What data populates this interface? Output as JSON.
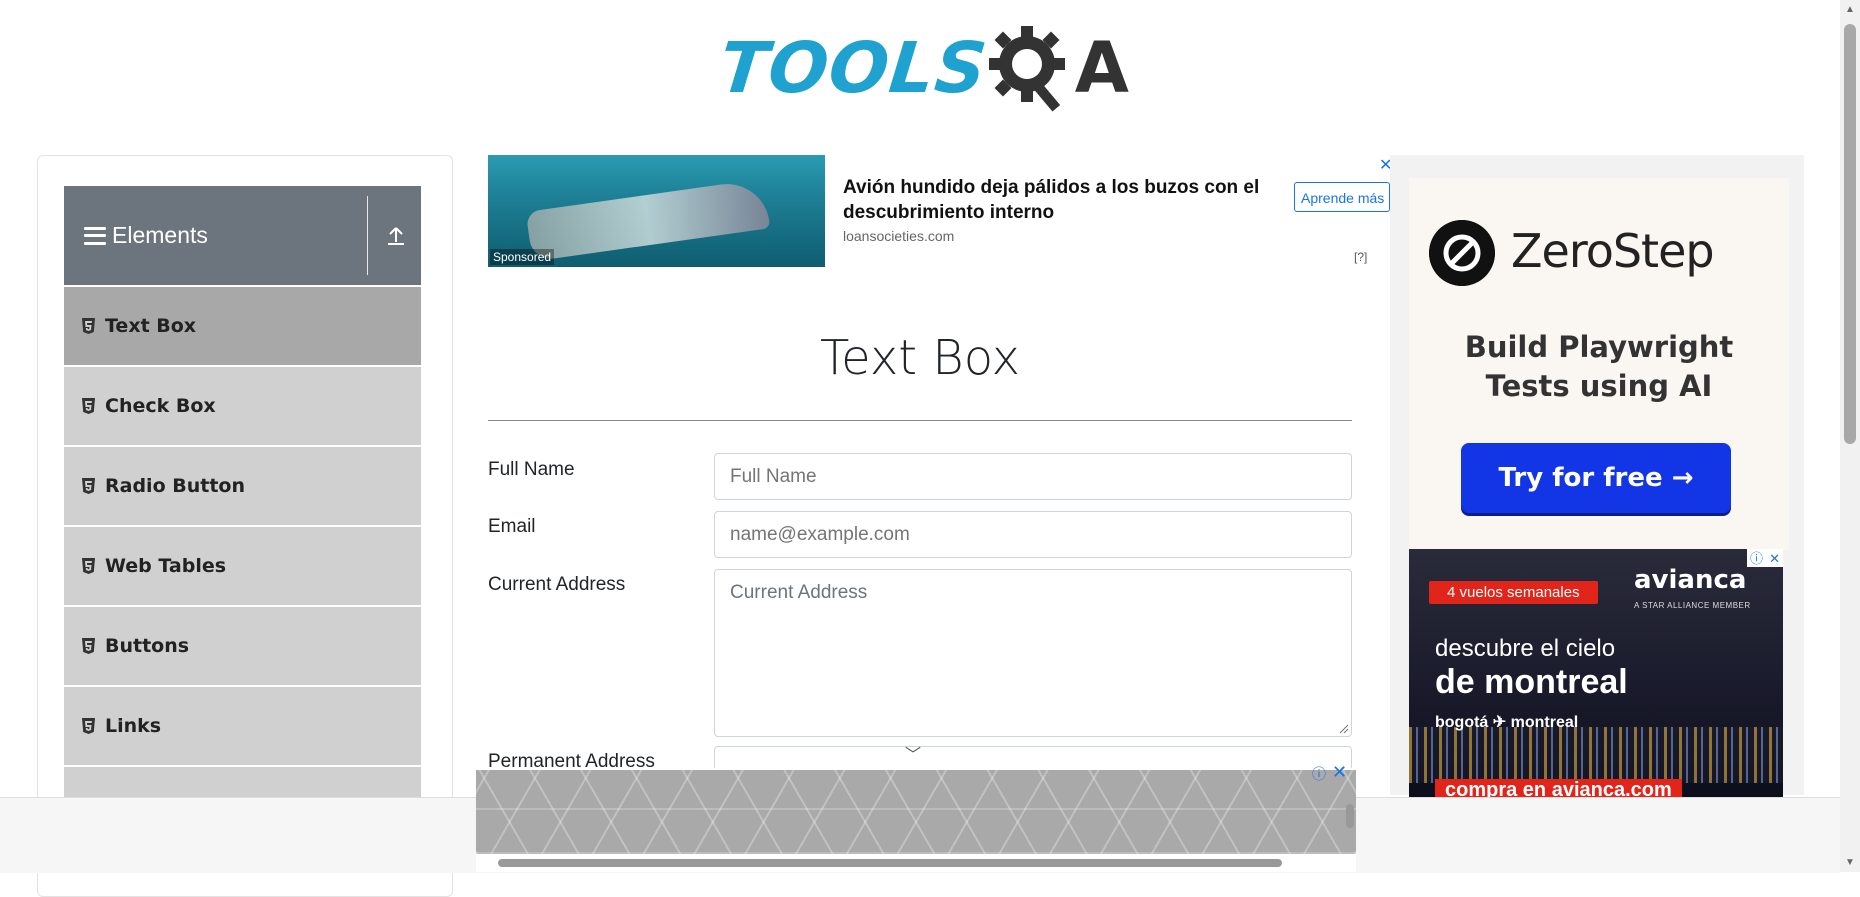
{
  "header": {
    "logo_tools": "TOOLS",
    "logo_qa": "A"
  },
  "sidebar": {
    "group_title": "Elements",
    "items": [
      {
        "label": "Text Box",
        "active": true
      },
      {
        "label": "Check Box",
        "active": false
      },
      {
        "label": "Radio Button",
        "active": false
      },
      {
        "label": "Web Tables",
        "active": false
      },
      {
        "label": "Buttons",
        "active": false
      },
      {
        "label": "Links",
        "active": false
      }
    ]
  },
  "top_ad": {
    "headline": "Avión hundido deja pálidos a los buzos con el descubrimiento interno",
    "domain": "loansocieties.com",
    "cta": "Aprende más",
    "sponsored": "Sponsored",
    "help": "[?]",
    "close": "✕"
  },
  "main": {
    "title": "Text Box",
    "fields": [
      {
        "label": "Full Name",
        "placeholder": "Full Name"
      },
      {
        "label": "Email",
        "placeholder": "name@example.com"
      },
      {
        "label": "Current Address",
        "placeholder": "Current Address"
      },
      {
        "label": "Permanent Address",
        "placeholder": ""
      }
    ]
  },
  "right_ad": {
    "zerostep": {
      "brand": "ZeroStep",
      "tagline_1": "Build Playwright",
      "tagline_2": "Tests using AI",
      "button": "Try for free →"
    },
    "avianca": {
      "badge": "4 vuelos semanales",
      "brand": "avianca",
      "alliance": "A STAR ALLIANCE MEMBER",
      "line1": "descubre el cielo",
      "line2": "de montreal",
      "route": "bogotá ✈ montreal",
      "cta": "compra en avianca.com"
    }
  },
  "colors": {
    "accent_blue": "#1fa2d0",
    "sidebar_header": "#6c757d",
    "menu_item": "#d0d0d0",
    "menu_item_active": "#a8a8a8",
    "zerostep_button": "#1235e6",
    "avianca_red": "#e1251b"
  }
}
